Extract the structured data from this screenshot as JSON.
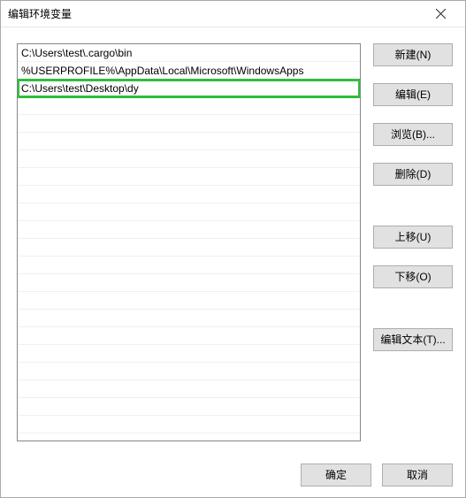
{
  "window": {
    "title": "编辑环境变量"
  },
  "list": {
    "items": [
      "C:\\Users\\test\\.cargo\\bin",
      "%USERPROFILE%\\AppData\\Local\\Microsoft\\WindowsApps",
      "C:\\Users\\test\\Desktop\\dy"
    ],
    "highlighted_index": 2,
    "visible_rows": 22
  },
  "buttons": {
    "new": "新建(N)",
    "edit": "编辑(E)",
    "browse": "浏览(B)...",
    "delete": "删除(D)",
    "moveup": "上移(U)",
    "movedown": "下移(O)",
    "edittext": "编辑文本(T)...",
    "ok": "确定",
    "cancel": "取消"
  }
}
